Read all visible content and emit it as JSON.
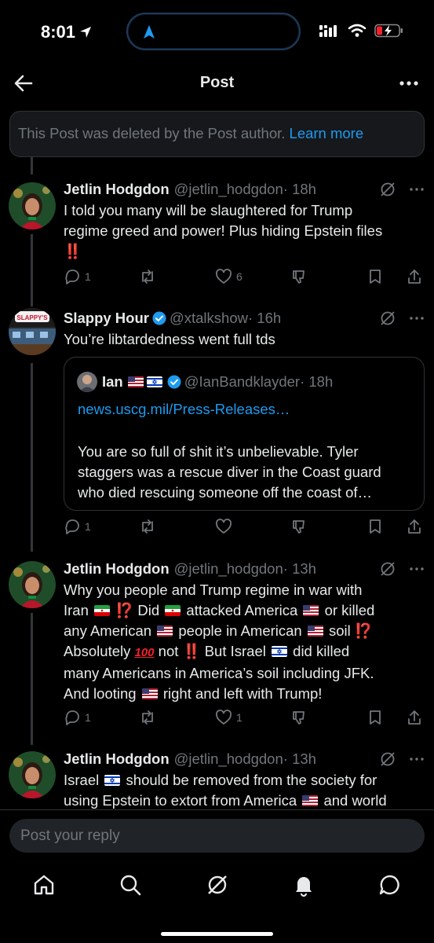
{
  "status": {
    "time": "8:01"
  },
  "header": {
    "title": "Post"
  },
  "deleted_notice": {
    "text": "This Post was deleted by the Post author.",
    "link": "Learn more"
  },
  "tweets": [
    {
      "name": "Jetlin Hodgdon",
      "handle": "@jetlin_hodgdon",
      "time": "· 18h",
      "text_lines": [
        "I told you many will be slaughtered for Trump",
        "regime greed and power! Plus hiding Epstein files"
      ],
      "emoji_line": "‼️",
      "replies": "1",
      "reposts": "",
      "likes": "6"
    },
    {
      "name": "Slappy Hour",
      "handle": "@xtalkshow",
      "time": "· 16h",
      "text": "You’re libtardedness went full tds",
      "replies": "1",
      "reposts": "",
      "likes": "",
      "quote": {
        "name": "Ian",
        "handle": "@IanBandklayder",
        "time": "· 18h",
        "link": "news.uscg.mil/Press-Releases…",
        "text_lines": [
          "You are so full of shit it’s unbelievable.  Tyler",
          "staggers was a rescue diver in the Coast guard",
          "who died rescuing someone off the coast of…"
        ]
      }
    },
    {
      "name": "Jetlin Hodgdon",
      "handle": "@jetlin_hodgdon",
      "time": "· 13h",
      "replies": "1",
      "reposts": "",
      "likes": "1",
      "seg": {
        "l1a": "Why you people and Trump regime in war with",
        "l2a": "Iran",
        "l2b": "Did",
        "l2c": "attacked America",
        "l2d": "or killed",
        "l3a": "any American",
        "l3b": "people in American",
        "l3c": "soil",
        "l4a": "Absolutely",
        "l4b": "not",
        "l4c": "But Israel",
        "l4d": "did killed",
        "l5": "many Americans in America’s soil including JFK.",
        "l6a": "And looting",
        "l6b": "right and left with Trump!",
        "interrobang": "⁉️",
        "double_bang": "‼️",
        "hundred": "100"
      }
    },
    {
      "name": "Jetlin Hodgdon",
      "handle": "@jetlin_hodgdon",
      "time": "· 13h",
      "seg": {
        "l1a": "Israel",
        "l1b": "should be removed from the society for",
        "l2a": "using Epstein to extort from America",
        "l2b": "and world"
      }
    }
  ],
  "reply": {
    "placeholder": "Post your reply"
  },
  "tabs": [
    "home-icon",
    "search-icon",
    "grok-icon",
    "notifications-icon",
    "messages-icon"
  ],
  "colors": {
    "accent": "#1d9bf0",
    "muted": "#71767b",
    "background": "#000000",
    "red": "#f4212e"
  }
}
